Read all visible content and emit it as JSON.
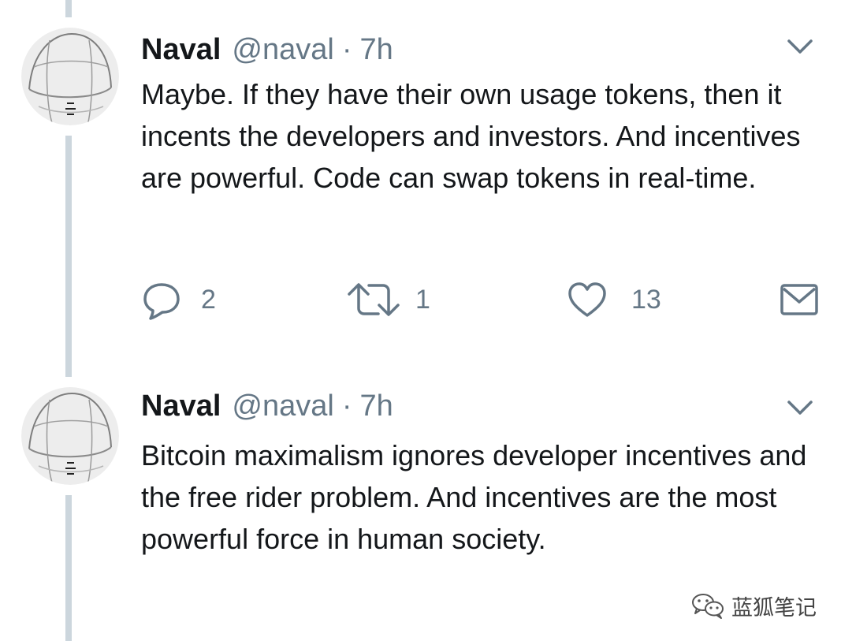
{
  "tweets": [
    {
      "author_name": "Naval",
      "author_handle": "@naval",
      "separator": "·",
      "timestamp": "7h",
      "text": "Maybe. If they have their own usage tokens, then it incents the developers and investors. And incentives are powerful. Code can swap tokens in real-time.",
      "replies": "2",
      "retweets": "1",
      "likes": "13"
    },
    {
      "author_name": "Naval",
      "author_handle": "@naval",
      "separator": "·",
      "timestamp": "7h",
      "text": "Bitcoin maximalism ignores developer incentives and the free rider problem. And incentives are the most powerful force in human society."
    }
  ],
  "watermark": {
    "label": "蓝狐笔记",
    "icon": "wechat-icon"
  },
  "colors": {
    "text_primary": "#14171a",
    "text_secondary": "#657786",
    "thread_line": "#ccd6dd",
    "background": "#ffffff"
  },
  "icons": {
    "reply": "reply-icon",
    "retweet": "retweet-icon",
    "like": "heart-icon",
    "direct_message": "envelope-icon",
    "menu": "chevron-down-icon"
  }
}
